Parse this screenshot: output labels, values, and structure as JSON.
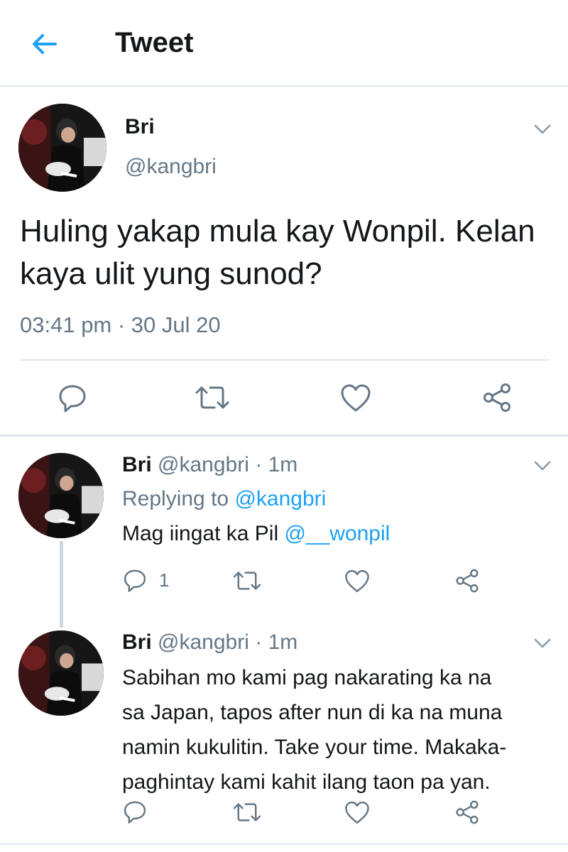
{
  "header": {
    "title": "Tweet",
    "back_icon": "arrow-left-icon"
  },
  "colors": {
    "accent": "#1da1f2",
    "text": "#14171a",
    "muted": "#657786",
    "border": "#e1e8ed",
    "thread_line": "#ccd6dd"
  },
  "main_tweet": {
    "name": "Bri",
    "handle": "@kangbri",
    "text": "Huling yakap mula kay Wonpil. Kelan kaya ulit yung sunod?",
    "timestamp": "03:41 pm · 30 Jul 20",
    "actions": [
      "reply-icon",
      "retweet-icon",
      "like-icon",
      "share-icon"
    ]
  },
  "replies": [
    {
      "name": "Bri",
      "handle": "@kangbri",
      "dot": "·",
      "time": "1m",
      "replying_to_label": "Replying to",
      "replying_to_handle": "@kangbri",
      "text": "Mag iingat ka Pil",
      "mention": "@__wonpil",
      "reply_count": "1"
    },
    {
      "name": "Bri",
      "handle": "@kangbri",
      "dot": "·",
      "time": "1m",
      "text_lines": [
        "Sabihan mo kami pag nakarating ka na",
        "sa Japan, tapos after nun di ka na muna",
        "namin kukulitin. Take your time. Makaka-",
        "paghintay kami kahit ilang taon pa yan."
      ]
    }
  ]
}
